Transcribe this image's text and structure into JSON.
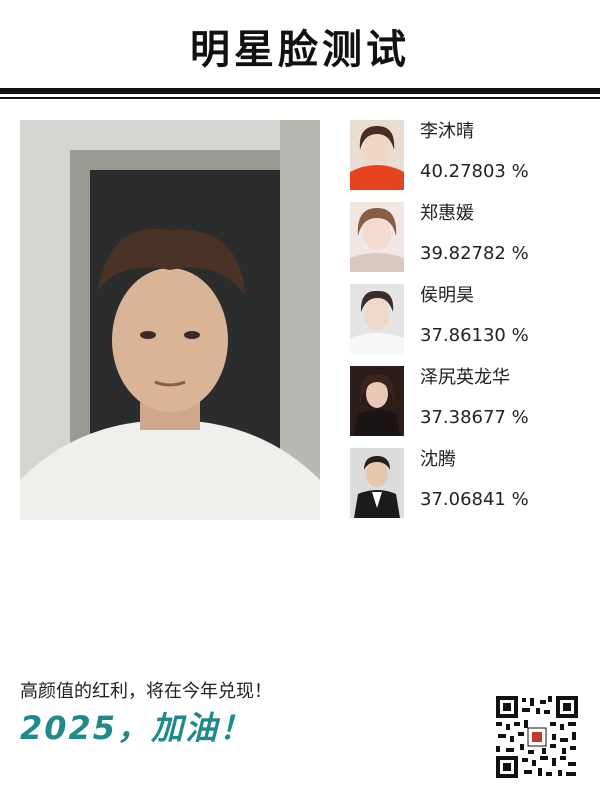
{
  "header": {
    "title": "明星脸测试"
  },
  "matches": [
    {
      "name": "李沐晴",
      "score": "40.27803 %"
    },
    {
      "name": "郑惠媛",
      "score": "39.82782 %"
    },
    {
      "name": "侯明昊",
      "score": "37.86130 %"
    },
    {
      "name": "泽尻英龙华",
      "score": "37.38677 %"
    },
    {
      "name": "沈腾",
      "score": "37.06841 %"
    }
  ],
  "footer": {
    "slogan": "高颜值的红利，将在今年兑现！",
    "cheer": "2025，加油！"
  },
  "colors": {
    "accent": "#1f8a8a",
    "rule": "#111111"
  }
}
